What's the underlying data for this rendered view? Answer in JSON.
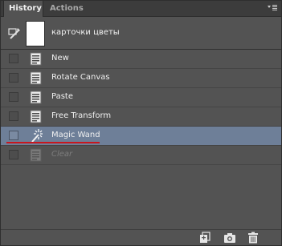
{
  "tabs": [
    {
      "label": "History",
      "active": true
    },
    {
      "label": "Actions",
      "active": false
    }
  ],
  "snapshot": {
    "name": "карточки цветы",
    "icon": "history-brush-icon"
  },
  "steps": [
    {
      "label": "New",
      "icon": "document-state-icon",
      "state": "normal"
    },
    {
      "label": "Rotate Canvas",
      "icon": "document-state-icon",
      "state": "normal"
    },
    {
      "label": "Paste",
      "icon": "document-state-icon",
      "state": "normal"
    },
    {
      "label": "Free Transform",
      "icon": "document-state-icon",
      "state": "normal"
    },
    {
      "label": "Magic Wand",
      "icon": "magic-wand-icon",
      "state": "selected"
    },
    {
      "label": "Clear",
      "icon": "document-state-icon",
      "state": "dimmed"
    }
  ],
  "footer_icons": [
    "new-document-from-state-icon",
    "camera-snapshot-icon",
    "trash-icon"
  ],
  "colors": {
    "selected_row": "#6e7f98",
    "underline_annotation": "#c8161d",
    "panel_bg": "#535353"
  }
}
